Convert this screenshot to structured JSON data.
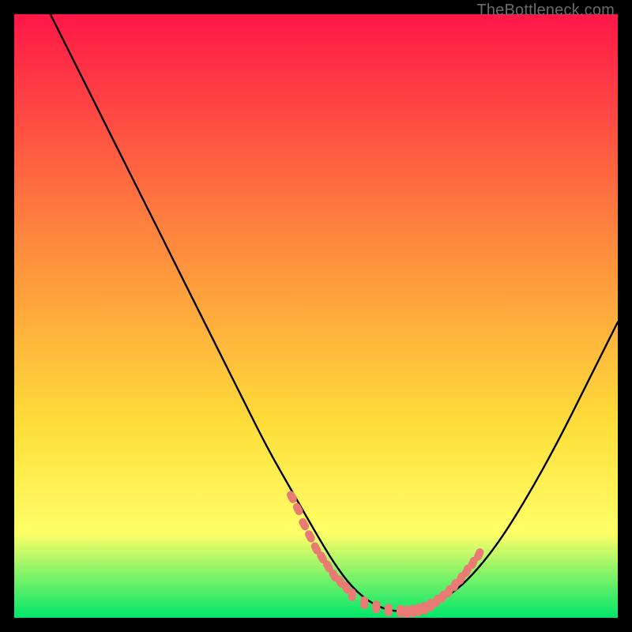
{
  "watermark": "TheBottleneck.com",
  "colors": {
    "gradient_top": "#ff1748",
    "gradient_mid1": "#ff813e",
    "gradient_mid2": "#ffde3a",
    "gradient_mid3": "#ffff68",
    "gradient_bottom": "#00e66a",
    "curve": "#000000",
    "markers": "#e97b74",
    "background": "#000000"
  },
  "chart_data": {
    "type": "line",
    "title": "",
    "xlabel": "",
    "ylabel": "",
    "ylim": [
      0,
      100
    ],
    "xlim": [
      0,
      100
    ],
    "series": [
      {
        "name": "curve",
        "x": [
          6,
          10,
          14,
          18,
          22,
          26,
          30,
          34,
          38,
          42,
          46,
          50,
          53,
          56,
          59,
          62,
          65,
          68,
          71,
          75,
          80,
          85,
          90,
          95,
          100
        ],
        "values": [
          100,
          92,
          84,
          76,
          68,
          60,
          52,
          44,
          36,
          28,
          21,
          14,
          9,
          5,
          2.5,
          1.2,
          1,
          1.5,
          3,
          6,
          12,
          20,
          29,
          39,
          49
        ]
      }
    ],
    "markers": [
      {
        "name": "falling-edge",
        "x": [
          46,
          47,
          48,
          49,
          50,
          51,
          52,
          53,
          54,
          55
        ],
        "values": [
          20,
          18,
          15.5,
          13.5,
          11.5,
          10,
          8.5,
          7,
          6,
          5
        ]
      },
      {
        "name": "valley",
        "x": [
          56,
          58,
          60,
          62,
          64,
          65,
          66,
          67,
          68,
          69
        ],
        "values": [
          3.8,
          2.5,
          1.8,
          1.3,
          1.1,
          1.0,
          1.1,
          1.3,
          1.6,
          2.1
        ]
      },
      {
        "name": "rising-edge",
        "x": [
          70,
          71,
          72,
          73,
          74,
          75,
          76,
          77
        ],
        "values": [
          2.8,
          3.5,
          4.4,
          5.4,
          6.5,
          7.8,
          9.1,
          10.5
        ]
      }
    ]
  }
}
